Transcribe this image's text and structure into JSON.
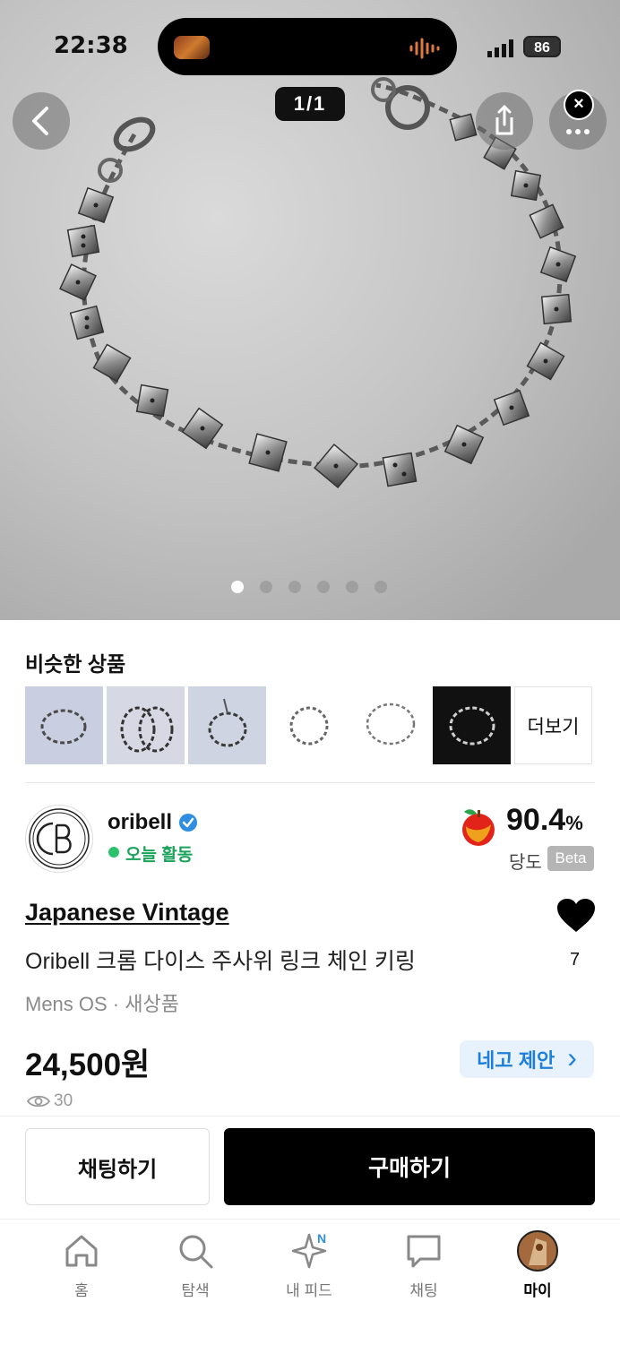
{
  "status_bar": {
    "time": "22:38",
    "battery": "86"
  },
  "hero": {
    "counter": "1/1",
    "close_symbol": "×",
    "image_dots": 6,
    "active_dot": 0
  },
  "similar": {
    "title": "비슷한 상품",
    "more_label": "더보기"
  },
  "seller": {
    "name": "oribell",
    "activity": "오늘 활동",
    "score": "90.4",
    "score_unit": "%",
    "score_label": "당도",
    "beta_label": "Beta"
  },
  "product": {
    "brand": "Japanese Vintage",
    "title": "Oribell 크롬 다이스 주사위 링크 체인 키링",
    "meta": "Mens OS · 새상품",
    "price": "24,500원",
    "likes": "7",
    "views": "30",
    "offer_label": "네고 제안",
    "offer_arrow": "›"
  },
  "actions": {
    "chat": "채팅하기",
    "buy": "구매하기"
  },
  "tabbar": {
    "badge": "N",
    "items": [
      {
        "label": "홈",
        "icon": "home-icon"
      },
      {
        "label": "탐색",
        "icon": "search-icon"
      },
      {
        "label": "내 피드",
        "icon": "sparkle-icon"
      },
      {
        "label": "채팅",
        "icon": "chat-bubble-icon"
      },
      {
        "label": "마이",
        "icon": "avatar"
      }
    ]
  },
  "colors": {
    "accent_blue": "#1d7fdb",
    "offer_bg": "#e8f2fc",
    "active_green": "#2cc26c",
    "buy_bg": "#000000"
  }
}
